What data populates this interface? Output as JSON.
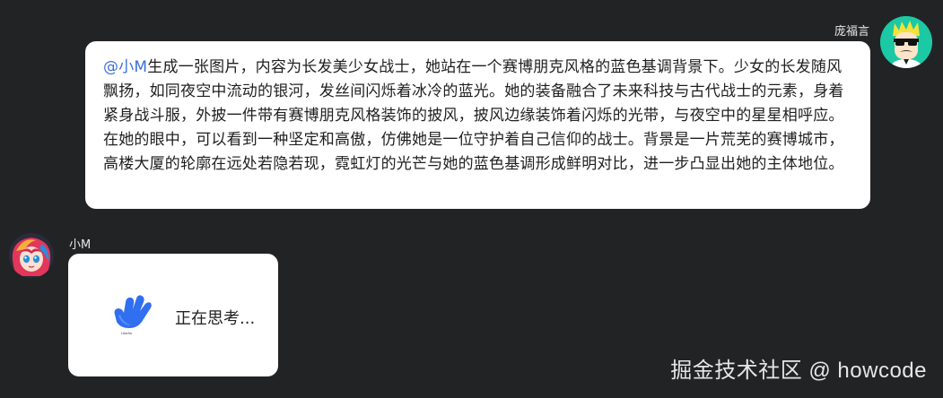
{
  "user_message": {
    "sender_name": "庞福言",
    "mention": "@小M",
    "text": "生成一张图片，内容为长发美少女战士，她站在一个赛博朋克风格的蓝色基调背景下。少女的长发随风飘扬，如同夜空中流动的银河，发丝间闪烁着冰冷的蓝光。她的装备融合了未来科技与古代战士的元素，身着紧身战斗服，外披一件带有赛博朋克风格装饰的披风，披风边缘装饰着闪烁的光带，与夜空中的星星相呼应。在她的眼中，可以看到一种坚定和高傲，仿佛她是一位守护着自己信仰的战士。背景是一片荒芜的赛博城市，高楼大厦的轮廓在远处若隐若现，霓虹灯的光芒与她的蓝色基调形成鲜明对比，进一步凸显出她的主体地位。",
    "avatar_icon": "sunglasses-face-avatar"
  },
  "bot_message": {
    "sender_name": "小M",
    "status_text": "正在思考...",
    "logo_caption": "LikeAs",
    "avatar_icon": "anime-girl-avatar"
  },
  "watermark": "掘金技术社区 @ howcode",
  "colors": {
    "background": "#222325",
    "bubble": "#ffffff",
    "mention": "#3a6fd8",
    "user_avatar_bg": "#1bc9a4",
    "logo_blue": "#2f6ff0"
  }
}
